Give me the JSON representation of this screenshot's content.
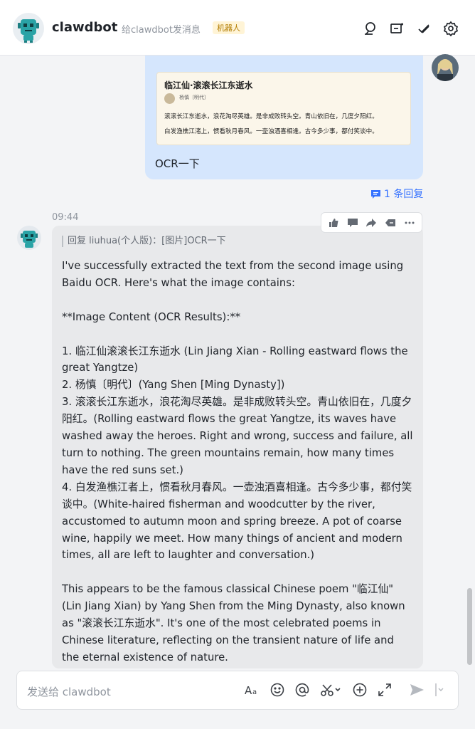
{
  "header": {
    "title": "clawdbot",
    "subtitle": "给clawdbot发消息",
    "tag": "机器人",
    "icons": [
      "search-icon",
      "add-chat-icon",
      "approve-icon",
      "settings-icon"
    ]
  },
  "user_message": {
    "image": {
      "title": "临江仙·滚滚长江东逝水",
      "author": "杨慎〔明代〕",
      "line1": "滚滚长江东逝水，浪花淘尽英雄。是非成败转头空。青山依旧在，几度夕阳红。",
      "line2": "白发渔樵江渚上，惯看秋月春风。一壶浊酒喜相逢。古今多少事，都付笑谈中。"
    },
    "text": "OCR一下",
    "reply_count": "1 条回复"
  },
  "bot_message": {
    "time": "09:44",
    "quote": "回复 liuhua(个人版)：[图片]OCR一下",
    "body": "I've successfully extracted the text from the second image using Baidu OCR. Here's what the image contains:\n\n**Image Content (OCR Results):**\n\n1. 临江仙滚滚长江东逝水 (Lin Jiang Xian - Rolling eastward flows the great Yangtze)\n2. 杨慎〔明代〕(Yang Shen [Ming Dynasty])\n3. 滚滚长江东逝水，浪花淘尽英雄。是非成败转头空。青山依旧在，几度夕阳红。(Rolling eastward flows the great Yangtze, its waves have washed away the heroes. Right and wrong, success and failure, all turn to nothing. The green mountains remain, how many times have the red suns set.)\n4. 白发渔樵江者上，惯看秋月春风。一壶浊酒喜相逢。古今多少事，都付笑谈中。(White-haired fisherman and woodcutter by the river, accustomed to autumn moon and spring breeze. A pot of coarse wine, happily we meet. How many things of ancient and modern times, all are left to laughter and conversation.)\n\nThis appears to be the famous classical Chinese poem \"临江仙\" (Lin Jiang Xian) by Yang Shen from the Ming Dynasty, also known as \"滚滚长江东逝水\". It's one of the most celebrated poems in Chinese literature, reflecting on the transient nature of life and the eternal existence of nature.",
    "toolbar": [
      "thumbs-up-icon",
      "comment-icon",
      "forward-icon",
      "tag-icon",
      "more-icon"
    ]
  },
  "composer": {
    "placeholder": "发送给 clawdbot",
    "icons": [
      "text-format-icon",
      "emoji-icon",
      "mention-icon",
      "scissors-icon",
      "add-icon",
      "expand-icon",
      "send-icon",
      "send-options-icon"
    ]
  },
  "colors": {
    "accent": "#3370ff",
    "user_bubble": "#d5e6fd",
    "bot_bubble": "#e8e9eb",
    "tag_bg": "#fff4d6"
  }
}
